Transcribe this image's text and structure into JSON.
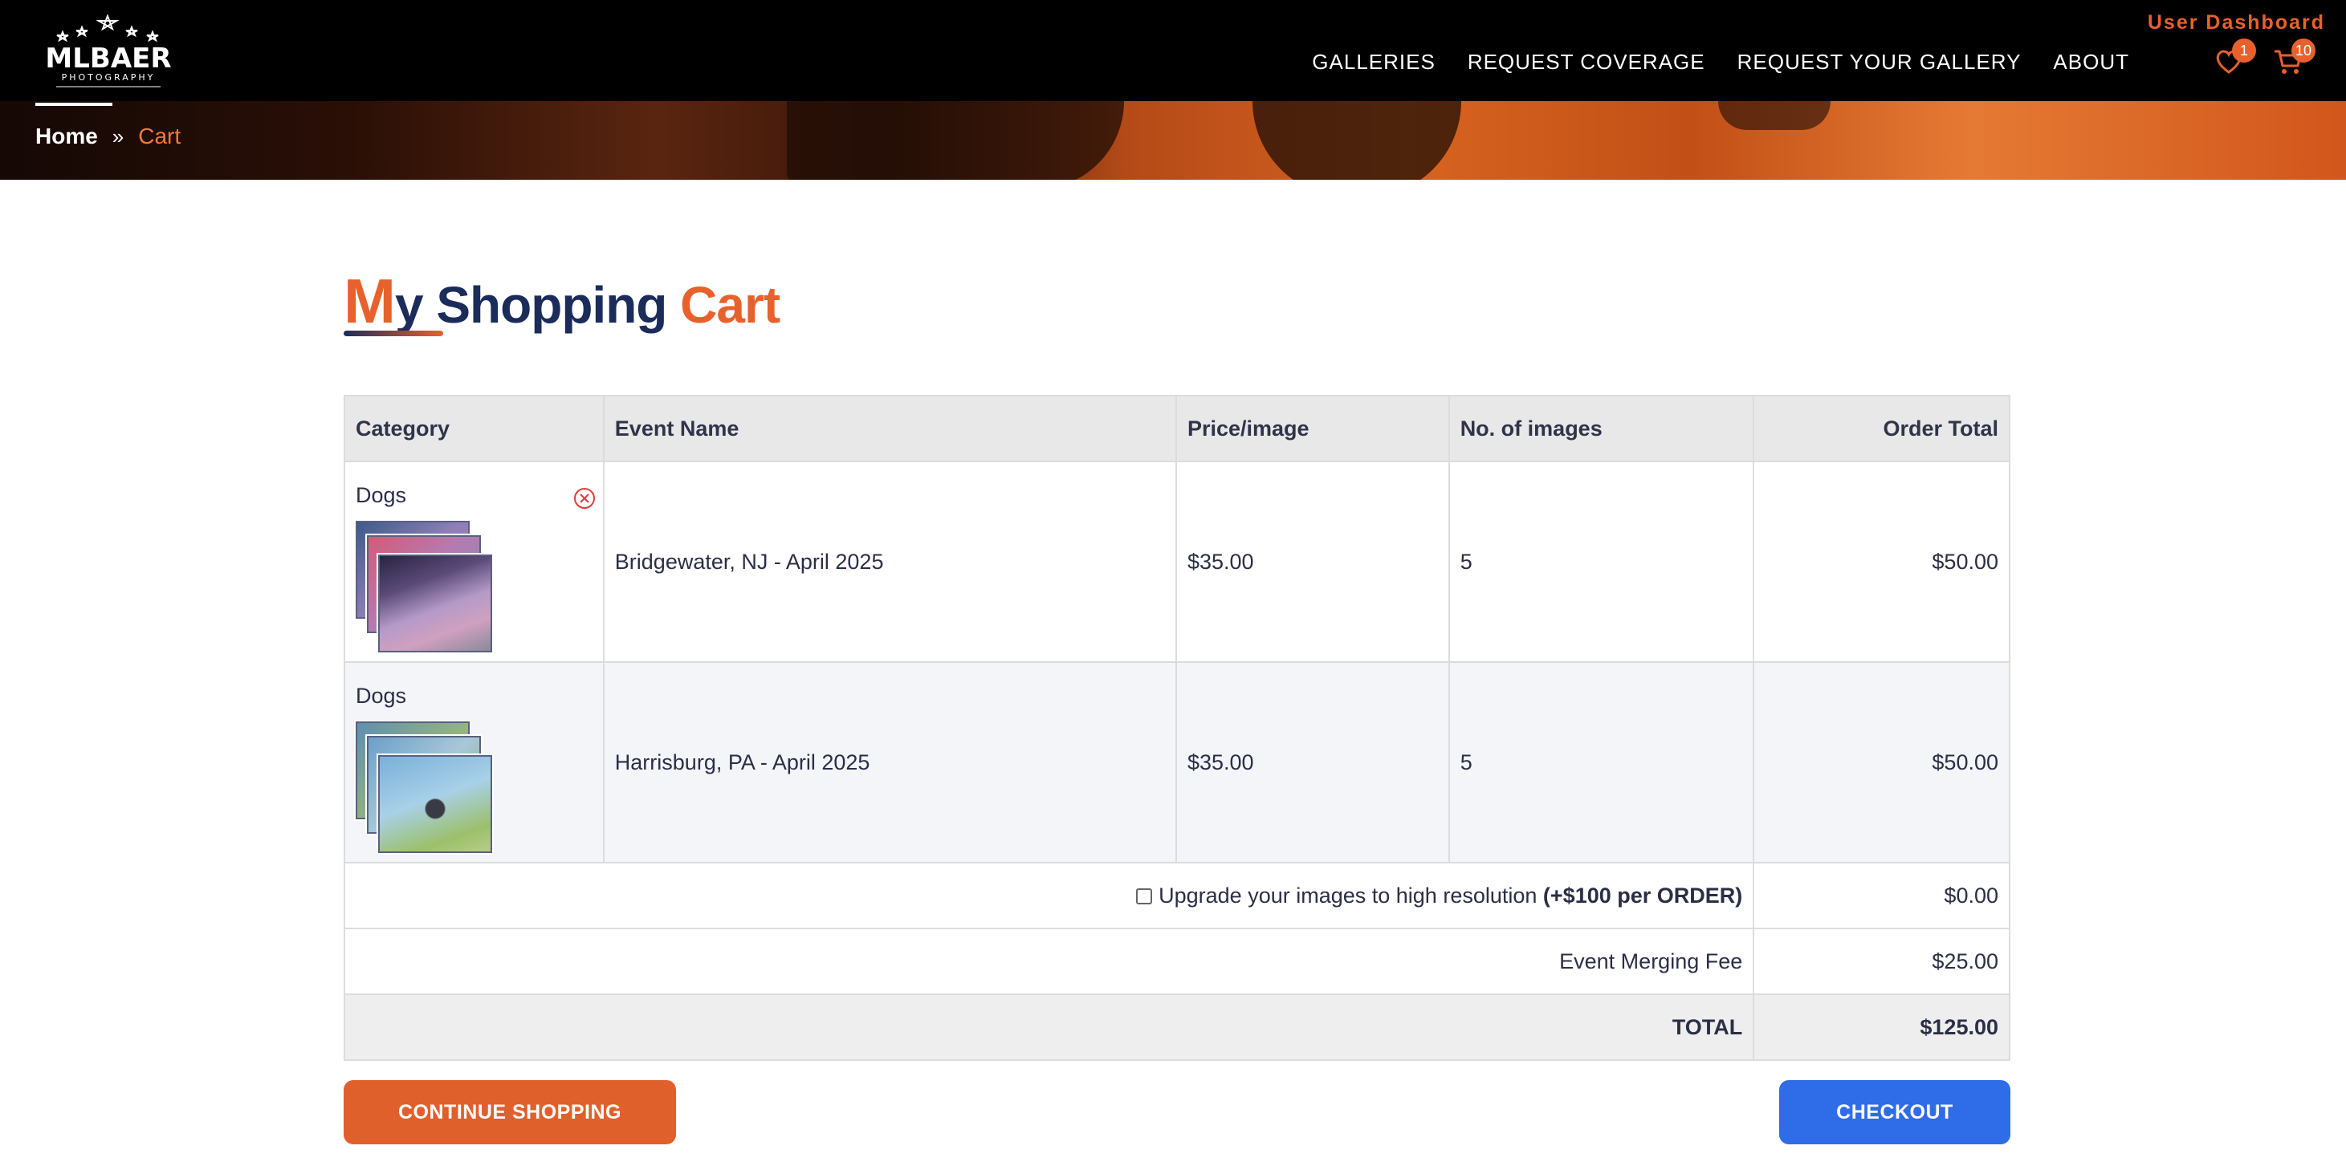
{
  "header": {
    "user_dashboard": "User Dashboard",
    "nav": [
      "GALLERIES",
      "REQUEST COVERAGE",
      "REQUEST YOUR GALLERY",
      "ABOUT"
    ],
    "wishlist_count": "1",
    "cart_count": "10",
    "logo_text": "MLBAER",
    "logo_sub": "PHOTOGRAPHY"
  },
  "breadcrumb": {
    "home": "Home",
    "sep": "»",
    "current": "Cart"
  },
  "title": {
    "m": "M",
    "y": "y",
    "mid": " Shopping ",
    "cart": "Cart"
  },
  "table": {
    "headers": [
      "Category",
      "Event Name",
      "Price/image",
      "No. of images",
      "Order Total"
    ],
    "rows": [
      {
        "category": "Dogs",
        "event": "Bridgewater, NJ - April 2025",
        "price": "$35.00",
        "count": "5",
        "total": "$50.00"
      },
      {
        "category": "Dogs",
        "event": "Harrisburg, PA - April 2025",
        "price": "$35.00",
        "count": "5",
        "total": "$50.00"
      }
    ],
    "upgrade_label": "Upgrade your images to high resolution",
    "upgrade_note": "(+$100 per ORDER)",
    "upgrade_value": "$0.00",
    "merge_label": "Event Merging Fee",
    "merge_value": "$25.00",
    "total_label": "TOTAL",
    "total_value": "$125.00"
  },
  "buttons": {
    "continue": "CONTINUE SHOPPING",
    "checkout": "CHECKOUT"
  },
  "colors": {
    "accent": "#e8612c",
    "navy": "#1b2c5a",
    "checkout": "#2f6ce8",
    "header_bg": "#000000"
  },
  "icons": {
    "wishlist": "heart-icon",
    "cart": "cart-icon",
    "remove": "remove-circle-icon",
    "breadcrumb_sep": "double-chevron-right-icon"
  }
}
